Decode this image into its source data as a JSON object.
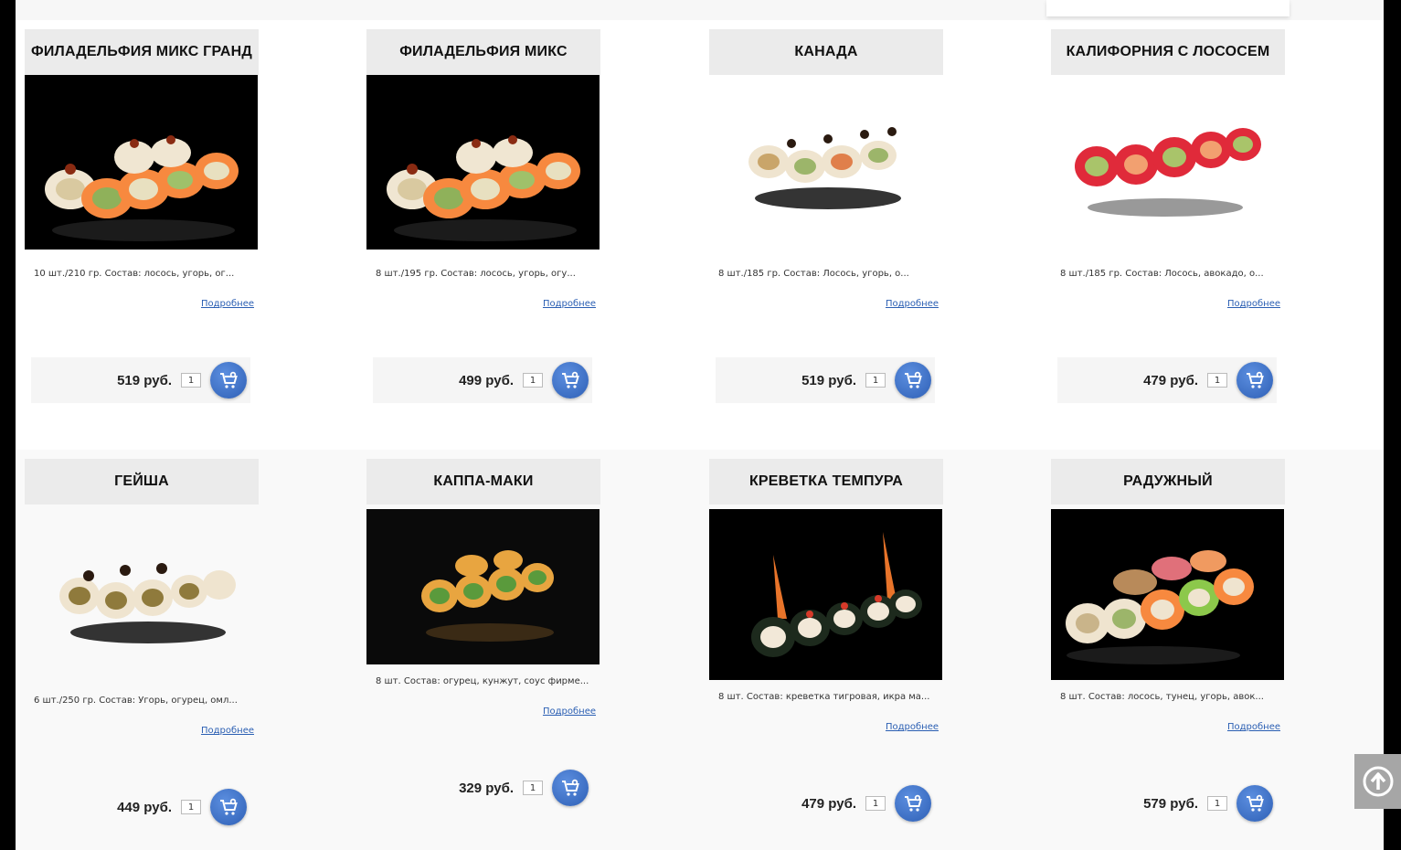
{
  "products": [
    {
      "title": "ФИЛАДЕЛЬФИЯ МИКС ГРАНД",
      "desc": "10 шт./210 гр. Состав: лосось, угорь, ог...",
      "more": "Подробнее",
      "price": "519 руб.",
      "qty": "1",
      "image": "sushi-salmon-mix-dark"
    },
    {
      "title": "ФИЛАДЕЛЬФИЯ МИКС",
      "desc": "8 шт./195 гр. Состав: лосось, угорь, огу...",
      "more": "Подробнее",
      "price": "499 руб.",
      "qty": "1",
      "image": "sushi-salmon-mix-dark"
    },
    {
      "title": "КАНАДА",
      "desc": "8 шт./185 гр. Состав: Лосось, угорь, о...",
      "more": "Подробнее",
      "price": "519 руб.",
      "qty": "1",
      "image": "sushi-eel-white"
    },
    {
      "title": "КАЛИФОРНИЯ С ЛОСОСЕМ",
      "desc": "8 шт./185 гр. Состав: Лосось, авокадо, о...",
      "more": "Подробнее",
      "price": "479 руб.",
      "qty": "1",
      "image": "sushi-red-caviar-white"
    },
    {
      "title": "ГЕЙША",
      "desc": "6 шт./250 гр. Состав: Угорь, огурец, омл...",
      "more": "Подробнее",
      "price": "449 руб.",
      "qty": "1",
      "image": "sushi-geisha-white"
    },
    {
      "title": "КАППА-МАКИ",
      "desc": "8 шт. Состав: огурец, кунжут, соус фирме...",
      "more": "Подробнее",
      "price": "329 руб.",
      "qty": "1",
      "image": "sushi-kappa-dark"
    },
    {
      "title": "КРЕВЕТКА ТЕМПУРА",
      "desc": "8 шт. Состав: креветка тигровая, икра ма...",
      "more": "Подробнее",
      "price": "479 руб.",
      "qty": "1",
      "image": "sushi-tempura-dark"
    },
    {
      "title": "РАДУЖНЫЙ",
      "desc": "8 шт. Состав: лосось, тунец, угорь, авок...",
      "more": "Подробнее",
      "price": "579 руб.",
      "qty": "1",
      "image": "sushi-rainbow-dark"
    }
  ],
  "icons": {
    "cart": "add-to-cart-icon",
    "scroll_top": "arrow-up-circle-icon"
  },
  "colors": {
    "accent": "#3a6cc4",
    "title_bg": "#ebebeb",
    "link": "#2b5fb3"
  }
}
